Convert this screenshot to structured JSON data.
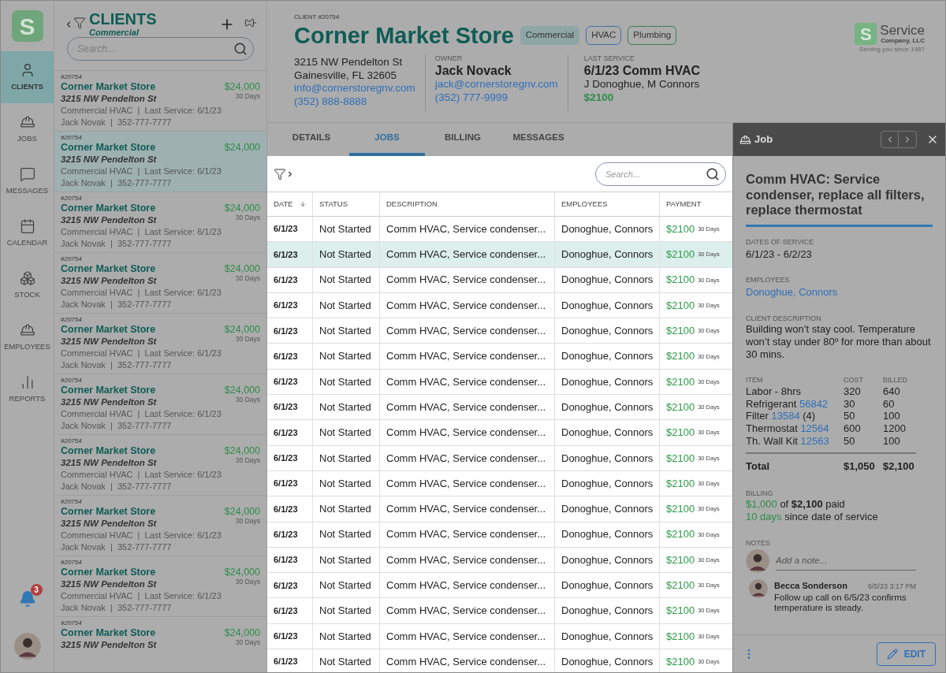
{
  "nav": {
    "logo": "S",
    "items": [
      {
        "kind": "clients",
        "label": "CLIENTS",
        "selected": true
      },
      {
        "kind": "jobs",
        "label": "JOBS",
        "selected": false
      },
      {
        "kind": "messages",
        "label": "MESSAGES",
        "selected": false
      },
      {
        "kind": "calendar",
        "label": "CALENDAR",
        "selected": false
      },
      {
        "kind": "stock",
        "label": "STOCK",
        "selected": false
      },
      {
        "kind": "employees",
        "label": "EMPLOYEES",
        "selected": false
      },
      {
        "kind": "reports",
        "label": "REPORTS",
        "selected": false
      }
    ],
    "notifications": "3"
  },
  "client_list": {
    "title": "CLIENTS",
    "subtitle": "Commercial",
    "search": {
      "placeholder": "Search..."
    },
    "items": [
      {
        "number": "#20754",
        "name": "Corner Market Store",
        "address": "3215 NW Pendelton St",
        "amount": "$24,000",
        "terms": "30 Days",
        "service": "Commercial HVAC  |  Last Service: 6/1/23",
        "contact": "Jack Novak  |  352-777-7777",
        "selected": false
      },
      {
        "number": "#20754",
        "name": "Corner Market Store",
        "address": "3215 NW Pendelton St",
        "amount": "$24,000",
        "service": "Commercial HVAC  |  Last Service: 6/1/23",
        "contact": "Jack Novak  |  352-777-7777",
        "selected": true
      },
      {
        "number": "#20754",
        "name": "Corner Market Store",
        "address": "3215 NW Pendelton St",
        "amount": "$24,000",
        "terms": "30 Days",
        "service": "Commercial HVAC  |  Last Service: 6/1/23",
        "contact": "Jack Novak  |  352-777-7777",
        "selected": false
      },
      {
        "number": "#20754",
        "name": "Corner Market Store",
        "address": "3215 NW Pendelton St",
        "amount": "$24,000",
        "terms": "30 Days",
        "service": "Commercial HVAC  |  Last Service: 6/1/23",
        "contact": "Jack Novak  |  352-777-7777",
        "selected": false
      },
      {
        "number": "#20754",
        "name": "Corner Market Store",
        "address": "3215 NW Pendelton St",
        "amount": "$24,000",
        "terms": "30 Days",
        "service": "Commercial HVAC  |  Last Service: 6/1/23",
        "contact": "Jack Novak  |  352-777-7777",
        "selected": false
      },
      {
        "number": "#20754",
        "name": "Corner Market Store",
        "address": "3215 NW Pendelton St",
        "amount": "$24,000",
        "terms": "30 Days",
        "service": "Commercial HVAC  |  Last Service: 6/1/23",
        "contact": "Jack Novak  |  352-777-7777",
        "selected": false
      },
      {
        "number": "#20754",
        "name": "Corner Market Store",
        "address": "3215 NW Pendelton St",
        "amount": "$24,000",
        "terms": "30 Days",
        "service": "Commercial HVAC  |  Last Service: 6/1/23",
        "contact": "Jack Novak  |  352-777-7777",
        "selected": false
      },
      {
        "number": "#20754",
        "name": "Corner Market Store",
        "address": "3215 NW Pendelton St",
        "amount": "$24,000",
        "terms": "30 Days",
        "service": "Commercial HVAC  |  Last Service: 6/1/23",
        "contact": "Jack Novak  |  352-777-7777",
        "selected": false
      },
      {
        "number": "#20754",
        "name": "Corner Market Store",
        "address": "3215 NW Pendelton St",
        "amount": "$24,000",
        "terms": "30 Days",
        "service": "Commercial HVAC  |  Last Service: 6/1/23",
        "contact": "Jack Novak  |  352-777-7777",
        "selected": false
      },
      {
        "number": "#20754",
        "name": "Corner Market Store",
        "address": "3215 NW Pendelton St",
        "amount": "$24,000",
        "terms": "30 Days",
        "selected": false
      }
    ]
  },
  "client": {
    "number_label": "CLIENT #20754",
    "name": "Corner Market Store",
    "tags": [
      {
        "label": "Commercial",
        "kind": "filled",
        "color": "#8fa6a6"
      },
      {
        "label": "HVAC",
        "kind": "outline",
        "color": "#3f74a8"
      },
      {
        "label": "Plumbing",
        "kind": "outline",
        "color": "#3a8050"
      }
    ],
    "address": [
      "3215 NW Pendelton St",
      "Gainesville, FL 32605"
    ],
    "email": "info@cornerstoregnv.com",
    "phone": "(352) 888-8888",
    "owner": {
      "label": "OWNER",
      "name": "Jack Novack",
      "email": "jack@cornerstoregnv.com",
      "phone": "(352) 777-9999"
    },
    "last_service": {
      "label": "LAST SERVICE",
      "title": "6/1/23 Comm HVAC",
      "employees": "J Donoghue, M Connors",
      "amount": "$2100"
    }
  },
  "company_logo": {
    "mark": "S",
    "name": "Service",
    "suffix": "Company, LLC",
    "tagline": "Serving you since 1987"
  },
  "tabs": [
    {
      "label": "DETAILS",
      "selected": false
    },
    {
      "label": "JOBS",
      "selected": true
    },
    {
      "label": "BILLING",
      "selected": false
    },
    {
      "label": "MESSAGES",
      "selected": false
    }
  ],
  "jobs": {
    "search": {
      "placeholder": "Search..."
    },
    "columns": [
      "DATE",
      "STATUS",
      "DESCRIPTION",
      "EMPLOYEES",
      "PAYMENT"
    ],
    "rows": [
      {
        "date": "6/1/23",
        "status": "Not Started",
        "description": "Comm HVAC, Service condenser...",
        "employees": "Donoghue, Connors",
        "payment": "$2100",
        "terms": "30 Days",
        "selected": false
      },
      {
        "date": "6/1/23",
        "status": "Not Started",
        "description": "Comm HVAC, Service condenser...",
        "employees": "Donoghue, Connors",
        "payment": "$2100",
        "terms": "30 Days",
        "selected": true
      },
      {
        "date": "6/1/23",
        "status": "Not Started",
        "description": "Comm HVAC, Service condenser...",
        "employees": "Donoghue, Connors",
        "payment": "$2100",
        "terms": "30 Days",
        "selected": false
      },
      {
        "date": "6/1/23",
        "status": "Not Started",
        "description": "Comm HVAC, Service condenser...",
        "employees": "Donoghue, Connors",
        "payment": "$2100",
        "terms": "30 Days",
        "selected": false
      },
      {
        "date": "6/1/23",
        "status": "Not Started",
        "description": "Comm HVAC, Service condenser...",
        "employees": "Donoghue, Connors",
        "payment": "$2100",
        "terms": "30 Days",
        "selected": false
      },
      {
        "date": "6/1/23",
        "status": "Not Started",
        "description": "Comm HVAC, Service condenser...",
        "employees": "Donoghue, Connors",
        "payment": "$2100",
        "terms": "30 Days",
        "selected": false
      },
      {
        "date": "6/1/23",
        "status": "Not Started",
        "description": "Comm HVAC, Service condenser...",
        "employees": "Donoghue, Connors",
        "payment": "$2100",
        "terms": "30 Days",
        "selected": false
      },
      {
        "date": "6/1/23",
        "status": "Not Started",
        "description": "Comm HVAC, Service condenser...",
        "employees": "Donoghue, Connors",
        "payment": "$2100",
        "terms": "30 Days",
        "selected": false
      },
      {
        "date": "6/1/23",
        "status": "Not Started",
        "description": "Comm HVAC, Service condenser...",
        "employees": "Donoghue, Connors",
        "payment": "$2100",
        "terms": "30 Days",
        "selected": false
      },
      {
        "date": "6/1/23",
        "status": "Not Started",
        "description": "Comm HVAC, Service condenser...",
        "employees": "Donoghue, Connors",
        "payment": "$2100",
        "terms": "30 Days",
        "selected": false
      },
      {
        "date": "6/1/23",
        "status": "Not Started",
        "description": "Comm HVAC, Service condenser...",
        "employees": "Donoghue, Connors",
        "payment": "$2100",
        "terms": "30 Days",
        "selected": false
      },
      {
        "date": "6/1/23",
        "status": "Not Started",
        "description": "Comm HVAC, Service condenser...",
        "employees": "Donoghue, Connors",
        "payment": "$2100",
        "terms": "30 Days",
        "selected": false
      },
      {
        "date": "6/1/23",
        "status": "Not Started",
        "description": "Comm HVAC, Service condenser...",
        "employees": "Donoghue, Connors",
        "payment": "$2100",
        "terms": "30 Days",
        "selected": false
      },
      {
        "date": "6/1/23",
        "status": "Not Started",
        "description": "Comm HVAC, Service condenser...",
        "employees": "Donoghue, Connors",
        "payment": "$2100",
        "terms": "30 Days",
        "selected": false
      },
      {
        "date": "6/1/23",
        "status": "Not Started",
        "description": "Comm HVAC, Service condenser...",
        "employees": "Donoghue, Connors",
        "payment": "$2100",
        "terms": "30 Days",
        "selected": false
      },
      {
        "date": "6/1/23",
        "status": "Not Started",
        "description": "Comm HVAC, Service condenser...",
        "employees": "Donoghue, Connors",
        "payment": "$2100",
        "terms": "30 Days",
        "selected": false
      },
      {
        "date": "6/1/23",
        "status": "Not Started",
        "description": "Comm HVAC, Service condenser...",
        "employees": "Donoghue, Connors",
        "payment": "$2100",
        "terms": "30 Days",
        "selected": false
      },
      {
        "date": "6/1/23",
        "status": "Not Started",
        "description": "Comm HVAC, Service condenser...",
        "employees": "Donoghue, Connors",
        "payment": "$2100",
        "terms": "30 Days",
        "selected": false
      }
    ]
  },
  "job_panel": {
    "title": "Job",
    "heading": "Comm HVAC: Service condenser, replace all filters, replace thermostat",
    "dates_label": "DATES OF SERVICE",
    "dates": "6/1/23 - 6/2/23",
    "employees_label": "EMPLOYEES",
    "employees": "Donoghue, Connors",
    "description_label": "CLIENT DESCRIPTION",
    "description": "Building won’t stay cool. Temperature won’t stay under 80º for more than about 30 mins.",
    "items_columns": [
      "ITEM",
      "COST",
      "BILLED"
    ],
    "items": [
      {
        "name": "Labor - 8hrs",
        "cost": "320",
        "billed": "640"
      },
      {
        "name": "Refrigerant",
        "code": "56842",
        "cost": "30",
        "billed": "60"
      },
      {
        "name": "Filter",
        "code": "13584",
        "suffix": "(4)",
        "cost": "50",
        "billed": "100"
      },
      {
        "name": "Thermostat",
        "code": "12564",
        "cost": "600",
        "billed": "1200"
      },
      {
        "name": "Th. Wall Kit",
        "code": "12563",
        "cost": "50",
        "billed": "100"
      }
    ],
    "total": {
      "label": "Total",
      "cost": "$1,050",
      "billed": "$2,100"
    },
    "billing_label": "BILLING",
    "billing": {
      "paid": "$1,000",
      "connector": "of",
      "total": "$2,100",
      "suffix": "paid",
      "days": "10 days",
      "days_suffix": "since date of service"
    },
    "notes_label": "NOTES",
    "note_placeholder": "Add a note...",
    "notes": [
      {
        "author": "Becca Sonderson",
        "time": "6/5/23 3:17 PM",
        "text": "Follow up call on 6/5/23 confirms temperature is steady."
      }
    ],
    "edit": "EDIT"
  }
}
